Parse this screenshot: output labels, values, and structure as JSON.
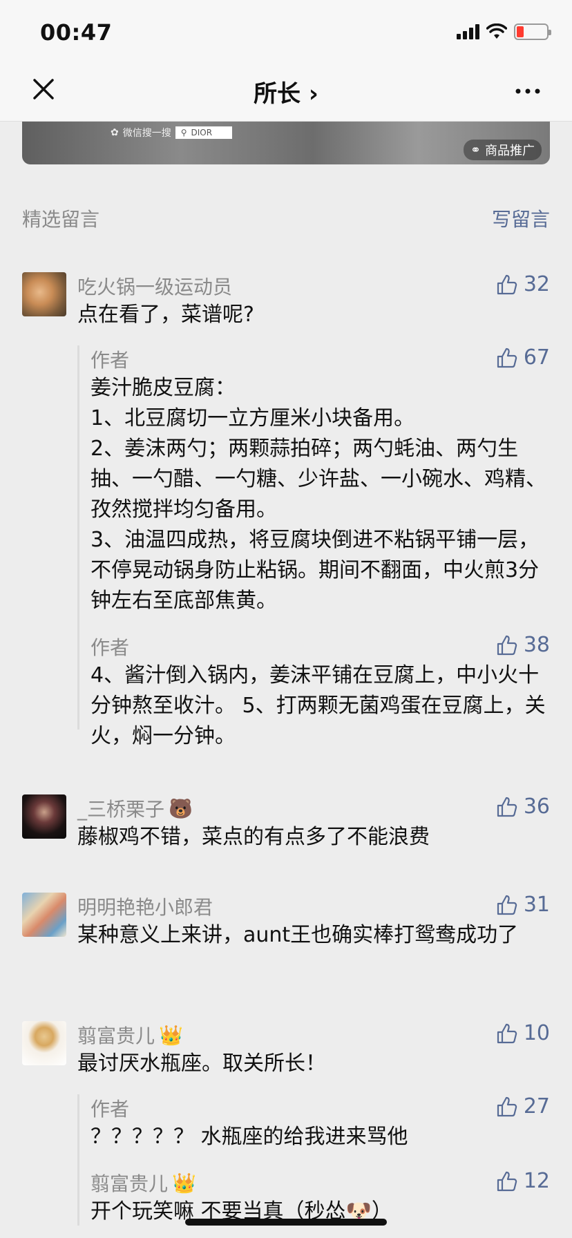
{
  "status_bar": {
    "time": "00:47",
    "battery_color": "#ff3b30"
  },
  "nav": {
    "title": "所长 ›",
    "close_icon": "close-icon",
    "more_icon": "more-icon"
  },
  "ad": {
    "search_text": "微信搜一搜",
    "search_query": "DIOR",
    "label": "商品推广"
  },
  "section": {
    "title": "精选留言",
    "write_label": "写留言"
  },
  "comments": [
    {
      "nickname": "吃火锅一级运动员",
      "likes": "32",
      "text": "点在看了，菜谱呢?",
      "replies": [
        {
          "nickname": "作者",
          "likes": "67",
          "text": "姜汁脆皮豆腐：\n1、北豆腐切一立方厘米小块备用。\n2、姜沫两勺；两颗蒜拍碎；两勺蚝油、两勺生抽、一勺醋、一勺糖、少许盐、一小碗水、鸡精、孜然搅拌均匀备用。\n3、油温四成热，将豆腐块倒进不粘锅平铺一层，不停晃动锅身防止粘锅。期间不翻面，中火煎3分钟左右至底部焦黄。"
        },
        {
          "nickname": "作者",
          "likes": "38",
          "text": "4、酱汁倒入锅内，姜沫平铺在豆腐上，中小火十分钟熬至收汁。 5、打两颗无菌鸡蛋在豆腐上，关火，焖一分钟。"
        }
      ]
    },
    {
      "nickname": "_三桥栗子",
      "nickname_emoji": "🐻",
      "likes": "36",
      "text": "藤椒鸡不错，菜点的有点多了不能浪费"
    },
    {
      "nickname": "明明艳艳小郎君",
      "likes": "31",
      "text": "某种意义上来讲，aunt王也确实棒打鸳鸯成功了"
    },
    {
      "nickname": "翦富贵儿",
      "nickname_emoji": "👑",
      "likes": "10",
      "text": "最讨厌水瓶座。取关所长！",
      "replies": [
        {
          "nickname": "作者",
          "likes": "27",
          "text": "？？？？？ 水瓶座的给我进来骂他"
        },
        {
          "nickname": "翦富贵儿",
          "nickname_emoji": "👑",
          "likes": "12",
          "text": "开个玩笑嘛 不要当真（秒怂🐶）"
        }
      ]
    }
  ],
  "colors": {
    "link": "#576b95",
    "meta": "#8a8a8a",
    "background": "#ededed"
  }
}
